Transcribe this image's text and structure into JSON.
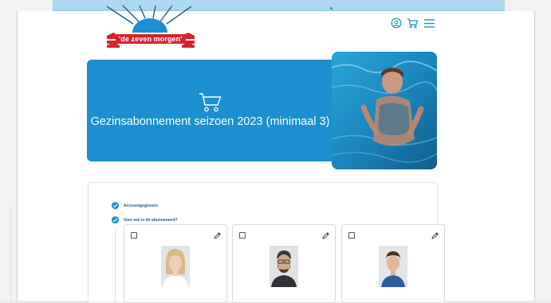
{
  "brand": {
    "logo_text": "'de zeven morgen'"
  },
  "header": {
    "icons": [
      "account-icon",
      "cart-icon",
      "menu-icon"
    ]
  },
  "hero": {
    "title": "Gezinsabonnement seizoen 2023 (minimaal 3)",
    "icon": "cart-icon",
    "color": "#1b8fd0"
  },
  "steps": [
    {
      "label": "Accountgegevens",
      "done": true
    },
    {
      "label": "Voor wie is dit abonnement?",
      "done": true
    }
  ],
  "members": [
    {
      "checked": false,
      "photo": "woman-avatar"
    },
    {
      "checked": false,
      "photo": "man-avatar"
    },
    {
      "checked": false,
      "photo": "boy-avatar"
    }
  ],
  "colors": {
    "accent": "#1b8fd0",
    "brand_red": "#d8232a"
  }
}
